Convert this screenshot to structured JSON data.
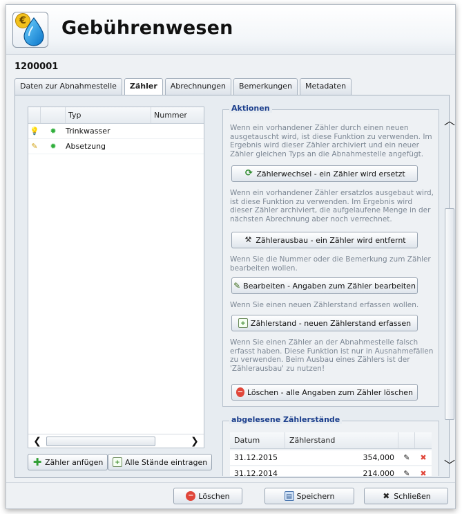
{
  "window": {
    "title": "Gebührenwesen",
    "icon": "euro-water-drop-icon",
    "record_id": "1200001"
  },
  "tabs": [
    {
      "label": "Daten zur Abnahmestelle",
      "active": false
    },
    {
      "label": "Zähler",
      "active": true
    },
    {
      "label": "Abrechnungen",
      "active": false
    },
    {
      "label": "Bemerkungen",
      "active": false
    },
    {
      "label": "Metadaten",
      "active": false
    }
  ],
  "meter_list": {
    "columns": [
      "",
      "",
      "Typ",
      "Nummer"
    ],
    "rows": [
      {
        "icon1": "lightbulb-icon",
        "icon2": "green-bulb-icon",
        "typ": "Trinkwasser",
        "nummer": ""
      },
      {
        "icon1": "pencil-icon",
        "icon2": "green-bulb-icon",
        "typ": "Absetzung",
        "nummer": ""
      }
    ],
    "add_button": "Zähler anfügen",
    "all_readings_button": "Alle Stände eintragen"
  },
  "actions": {
    "legend": "Aktionen",
    "items": [
      {
        "text": "Wenn ein vorhandener Zähler durch einen neuen ausgetauscht wird, ist diese Funktion zu verwenden. Im Ergebnis wird dieser Zähler archiviert und ein neuer Zähler gleichen Typs an die Abnahmestelle angefügt.",
        "button": "Zählerwechsel - ein Zähler wird ersetzt",
        "icon": "cycle-icon"
      },
      {
        "text": "Wenn ein vorhandener Zähler ersatzlos ausgebaut wird, ist diese Funktion zu verwenden. Im Ergebnis wird dieser Zähler archiviert, die aufgelaufene Menge in der nächsten Abrechnung aber noch verrechnet.",
        "button": "Zählerausbau - ein Zähler wird entfernt",
        "icon": "tools-icon"
      },
      {
        "text": "Wenn Sie die Nummer oder die Bemerkung zum Zähler bearbeiten wollen.",
        "button": "Bearbeiten - Angaben zum Zähler bearbeiten",
        "icon": "edit-icon"
      },
      {
        "text": "Wenn Sie einen neuen Zählerstand erfassen wollen.",
        "button": "Zählerstand - neuen Zählerstand erfassen",
        "icon": "new-document-icon"
      },
      {
        "text": "Wenn Sie einen Zähler an der Abnahmestelle falsch erfasst haben. Diese Funktion ist nur in Ausnahmefällen zu verwenden. Beim Ausbau eines Zählers ist der 'Zählerausbau' zu nutzen!",
        "button": "Löschen - alle Angaben zum Zähler löschen",
        "icon": "delete-icon"
      }
    ]
  },
  "readings": {
    "legend": "abgelesene Zählerstände",
    "columns": [
      "Datum",
      "Zählerstand"
    ],
    "rows": [
      {
        "datum": "31.12.2015",
        "stand": "354,000"
      },
      {
        "datum": "31.12.2014",
        "stand": "214,000"
      }
    ]
  },
  "footer": {
    "delete": "Löschen",
    "save": "Speichern",
    "close": "Schließen"
  },
  "colors": {
    "legend": "#1b3e8c",
    "hint_text": "#7c8794",
    "delete_red": "#e0463a"
  }
}
